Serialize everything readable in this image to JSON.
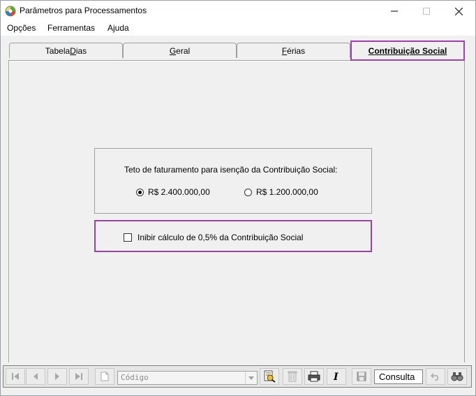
{
  "window": {
    "title": "Parâmetros para Processamentos"
  },
  "menu": {
    "items": [
      {
        "label": "Opções"
      },
      {
        "label": "Ferramentas"
      },
      {
        "label": "Ajuda"
      }
    ]
  },
  "tabs": [
    {
      "pre": "Tabela ",
      "key": "D",
      "post": "ias",
      "active": false
    },
    {
      "pre": "",
      "key": "G",
      "post": "eral",
      "active": false
    },
    {
      "pre": "",
      "key": "F",
      "post": "érias",
      "active": false
    },
    {
      "pre": "",
      "key": "C",
      "post": "ontribuição Social",
      "active": true
    }
  ],
  "contribuicao": {
    "group_label": "Teto de faturamento para isenção da Contribuição Social:",
    "options": [
      {
        "label": "R$ 2.400.000,00",
        "checked": true
      },
      {
        "label": "R$ 1.200.000,00",
        "checked": false
      }
    ],
    "inhibit_label": "Inibir cálculo de 0,5% da Contribuição Social",
    "inhibit_checked": false
  },
  "toolbar": {
    "search_placeholder": "Código",
    "mode": "Consulta"
  },
  "colors": {
    "highlight": "#a040b0"
  }
}
